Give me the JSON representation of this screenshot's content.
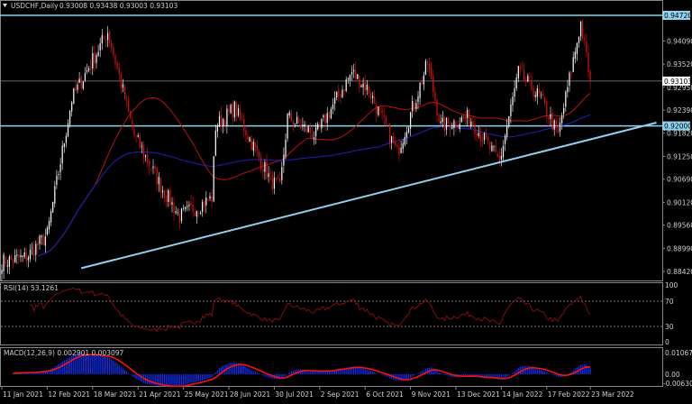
{
  "header": {
    "symbol": "USDCHF,Daily",
    "ohlc": "0.93008 0.93438 0.93003 0.93103"
  },
  "rsi": {
    "label": "RSI(14) 53.1261",
    "ticks": [
      "100",
      "70",
      "30",
      "0"
    ]
  },
  "macd": {
    "label": "MACD(12,26,9) 0.002901 0.003097",
    "ticks": [
      "0.01067",
      "0.00",
      "-0.006306"
    ]
  },
  "colors": {
    "bull": "#ffffff",
    "bear": "#e01010",
    "ma_fast": "#c01010",
    "ma_slow": "#2020c0",
    "level": "#8fd3ee",
    "trend": "#8fd3ee"
  },
  "chart_data": {
    "type": "candlestick",
    "title": "USDCHF,Daily",
    "ylim": [
      0.8833,
      0.9495
    ],
    "price_ticks": [
      "0.94090",
      "0.93520",
      "0.92950",
      "0.92390",
      "0.91820",
      "0.91250",
      "0.90690",
      "0.90120",
      "0.89560",
      "0.88990",
      "0.88420"
    ],
    "levels": [
      {
        "label": "0.94720",
        "value": 0.9472,
        "style": "level"
      },
      {
        "label": "0.93103",
        "value": 0.93103,
        "style": "current"
      },
      {
        "label": "0.92000",
        "value": 0.92,
        "style": "level"
      }
    ],
    "trendline": [
      {
        "bar": 42,
        "value": 0.885
      },
      {
        "bar": 346,
        "value": 0.9208
      }
    ],
    "date_labels": [
      {
        "bar": 0,
        "label": "11 Jan 2021"
      },
      {
        "bar": 24,
        "label": "12 Feb 2021"
      },
      {
        "bar": 48,
        "label": "18 Mar 2021"
      },
      {
        "bar": 72,
        "label": "21 Apr 2021"
      },
      {
        "bar": 96,
        "label": "25 May 2021"
      },
      {
        "bar": 120,
        "label": "28 Jun 2021"
      },
      {
        "bar": 144,
        "label": "30 Jul 2021"
      },
      {
        "bar": 168,
        "label": "2 Sep 2021"
      },
      {
        "bar": 192,
        "label": "6 Oct 2021"
      },
      {
        "bar": 216,
        "label": "9 Nov 2021"
      },
      {
        "bar": 240,
        "label": "13 Dec 2021"
      },
      {
        "bar": 264,
        "label": "14 Jan 2022"
      },
      {
        "bar": 288,
        "label": "17 Feb 2022"
      },
      {
        "bar": 311,
        "label": "23 Mar 2022"
      }
    ],
    "close_path": [
      [
        0,
        0.8866
      ],
      [
        13,
        0.8877
      ],
      [
        24,
        0.8933
      ],
      [
        37,
        0.9266
      ],
      [
        42,
        0.931
      ],
      [
        56,
        0.9432
      ],
      [
        70,
        0.9177
      ],
      [
        85,
        0.9044
      ],
      [
        94,
        0.8977
      ],
      [
        111,
        0.9022
      ],
      [
        113,
        0.9199
      ],
      [
        123,
        0.9244
      ],
      [
        142,
        0.9066
      ],
      [
        147,
        0.9044
      ],
      [
        151,
        0.9221
      ],
      [
        166,
        0.9177
      ],
      [
        185,
        0.9332
      ],
      [
        194,
        0.9288
      ],
      [
        209,
        0.9133
      ],
      [
        225,
        0.9354
      ],
      [
        232,
        0.9199
      ],
      [
        247,
        0.9221
      ],
      [
        263,
        0.911
      ],
      [
        273,
        0.9332
      ],
      [
        285,
        0.9266
      ],
      [
        294,
        0.9177
      ],
      [
        306,
        0.9454
      ],
      [
        311,
        0.931
      ]
    ]
  }
}
